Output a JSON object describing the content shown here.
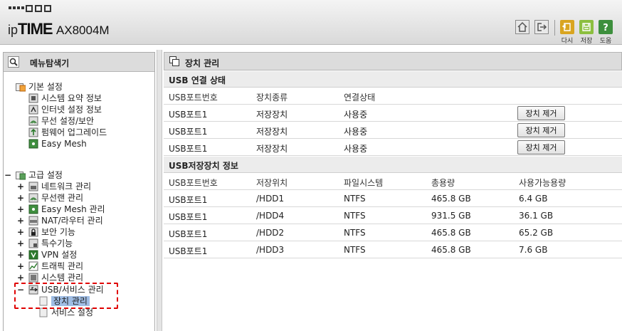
{
  "brand": {
    "ip": "ip",
    "time": "TIME",
    "model": "AX8004M"
  },
  "header_buttons": {
    "home_icon": "home-icon",
    "logout_icon": "logout-icon",
    "redo_label": "다시",
    "save_label": "저장",
    "help_label": "도움",
    "redo_color": "#d9a520",
    "save_color": "#8cbf3f",
    "help_color": "#3d8f3d"
  },
  "left_panel": {
    "title": "메뉴탐색기",
    "basic": {
      "label": "기본 설정",
      "items": [
        "시스템 요약 정보",
        "인터넷 설정 정보",
        "무선 설정/보안",
        "펌웨어 업그레이드",
        "Easy Mesh"
      ]
    },
    "advanced": {
      "toggle": "−",
      "label": "고급 설정",
      "items": [
        {
          "toggle": "+",
          "label": "네트워크 관리"
        },
        {
          "toggle": "+",
          "label": "무선랜 관리"
        },
        {
          "toggle": "+",
          "label": "Easy Mesh 관리"
        },
        {
          "toggle": "+",
          "label": "NAT/라우터 관리"
        },
        {
          "toggle": "+",
          "label": "보안 기능"
        },
        {
          "toggle": "+",
          "label": "특수기능"
        },
        {
          "toggle": "+",
          "label": "VPN 설정"
        },
        {
          "toggle": "+",
          "label": "트래픽 관리"
        },
        {
          "toggle": "+",
          "label": "시스템 관리"
        },
        {
          "toggle": "−",
          "label": "USB/서비스 관리"
        }
      ],
      "usb_children": [
        "장치 관리",
        "서비스 설정"
      ]
    }
  },
  "main": {
    "title": "장치 관리",
    "usb_status": {
      "title": "USB 연결 상태",
      "headers": [
        "USB포트번호",
        "장치종류",
        "연결상태"
      ],
      "rows": [
        {
          "port": "USB포트1",
          "type": "저장장치",
          "status": "사용중",
          "button": "장치 제거"
        },
        {
          "port": "USB포트1",
          "type": "저장장치",
          "status": "사용중",
          "button": "장치 제거"
        },
        {
          "port": "USB포트1",
          "type": "저장장치",
          "status": "사용중",
          "button": "장치 제거"
        }
      ]
    },
    "storage_info": {
      "title": "USB저장장치 정보",
      "headers": [
        "USB포트번호",
        "저장위치",
        "파일시스템",
        "총용량",
        "사용가능용량"
      ],
      "rows": [
        {
          "port": "USB포트1",
          "location": "/HDD1",
          "fs": "NTFS",
          "total": "465.8 GB",
          "free": "6.4 GB"
        },
        {
          "port": "USB포트1",
          "location": "/HDD4",
          "fs": "NTFS",
          "total": "931.5 GB",
          "free": "36.1 GB"
        },
        {
          "port": "USB포트1",
          "location": "/HDD2",
          "fs": "NTFS",
          "total": "465.8 GB",
          "free": "65.2 GB"
        },
        {
          "port": "USB포트1",
          "location": "/HDD3",
          "fs": "NTFS",
          "total": "465.8 GB",
          "free": "7.6 GB"
        }
      ]
    }
  }
}
